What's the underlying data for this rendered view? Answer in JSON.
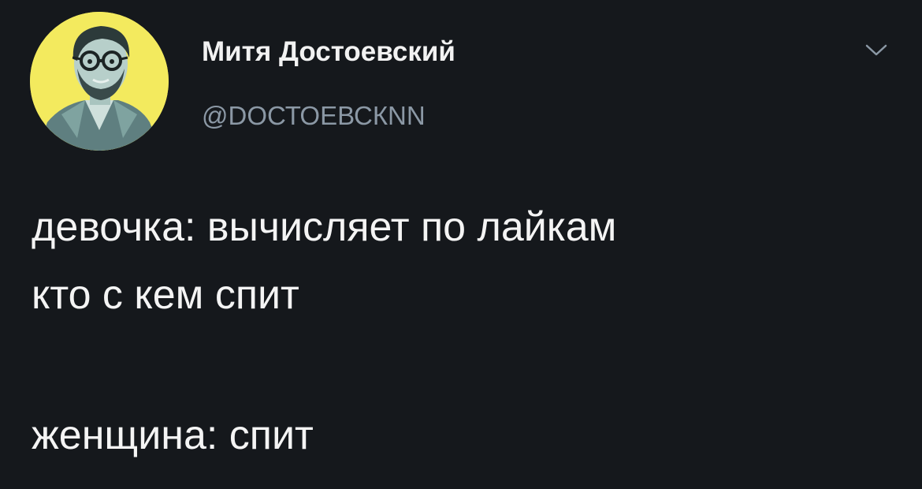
{
  "tweet": {
    "author": {
      "name": "Митя Достоевский",
      "handle": "@DОСТОЕВСКNN",
      "avatar_icon": "avatar-portrait",
      "avatar_bg": "#f3ea5e"
    },
    "menu_icon": "chevron-down-icon",
    "text_lines": [
      "девочка: вычисляет по лайкам",
      "кто с кем спит",
      "женщина: спит"
    ]
  },
  "colors": {
    "background": "#15181c",
    "text": "#f4f4f4",
    "secondary_text": "#8b98a5"
  }
}
